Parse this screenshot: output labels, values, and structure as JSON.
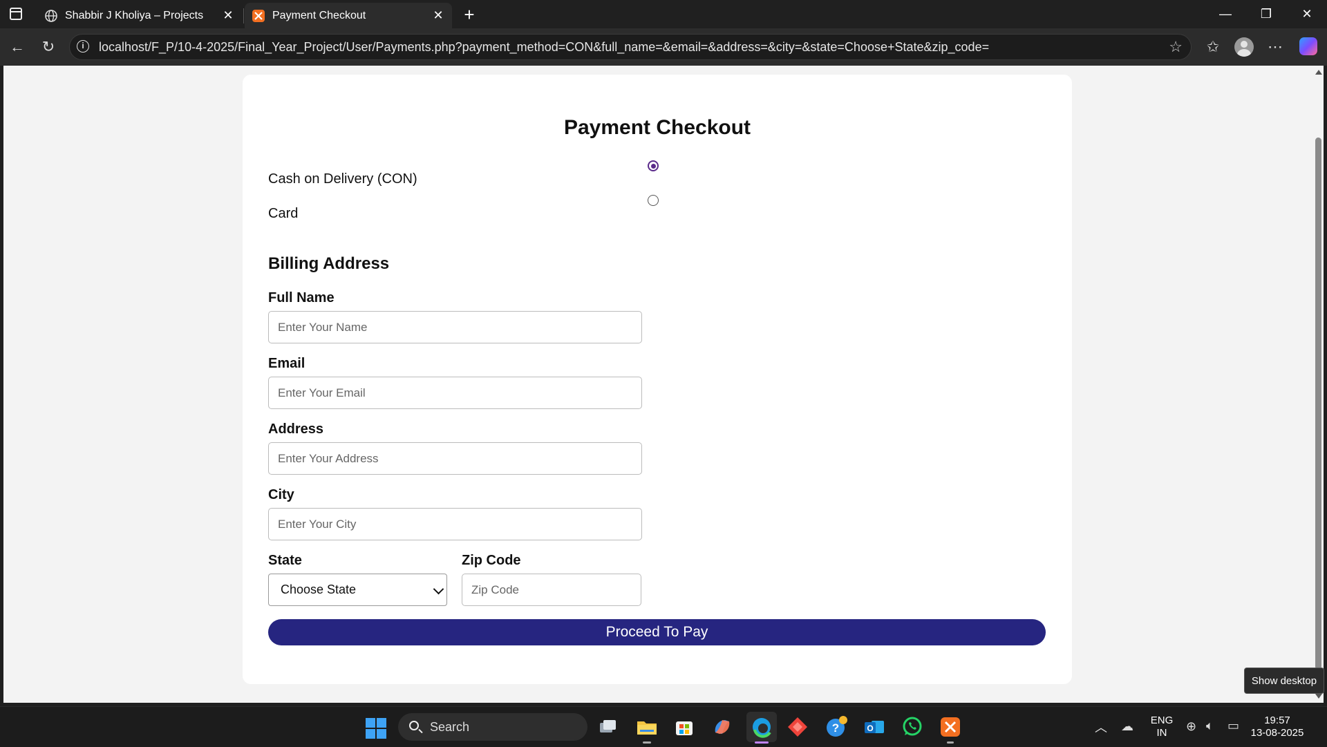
{
  "browser": {
    "tabs": [
      {
        "title": "Shabbir J Kholiya – Projects",
        "icon": "globe-icon"
      },
      {
        "title": "Payment Checkout",
        "icon": "xampp-icon",
        "active": true
      }
    ],
    "url": "localhost/F_P/10-4-2025/Final_Year_Project/User/Payments.php?payment_method=CON&full_name=&email=&address=&city=&state=Choose+State&zip_code="
  },
  "page": {
    "title": "Payment Checkout",
    "payment_methods": [
      {
        "label": "Cash on Delivery (CON)",
        "selected": true
      },
      {
        "label": "Card",
        "selected": false
      }
    ],
    "billing_heading": "Billing Address",
    "fields": {
      "full_name": {
        "label": "Full Name",
        "placeholder": "Enter Your Name"
      },
      "email": {
        "label": "Email",
        "placeholder": "Enter Your Email"
      },
      "address": {
        "label": "Address",
        "placeholder": "Enter Your Address"
      },
      "city": {
        "label": "City",
        "placeholder": "Enter Your City"
      },
      "state": {
        "label": "State",
        "value": "Choose State"
      },
      "zip": {
        "label": "Zip Code",
        "placeholder": "Zip Code"
      }
    },
    "submit_label": "Proceed To Pay"
  },
  "tooltip": "Show desktop",
  "taskbar": {
    "search_label": "Search",
    "lang_top": "ENG",
    "lang_bottom": "IN",
    "time": "19:57",
    "date": "13-08-2025"
  },
  "colors": {
    "accent_button": "#262580",
    "radio_checked": "#5a2a8a"
  }
}
